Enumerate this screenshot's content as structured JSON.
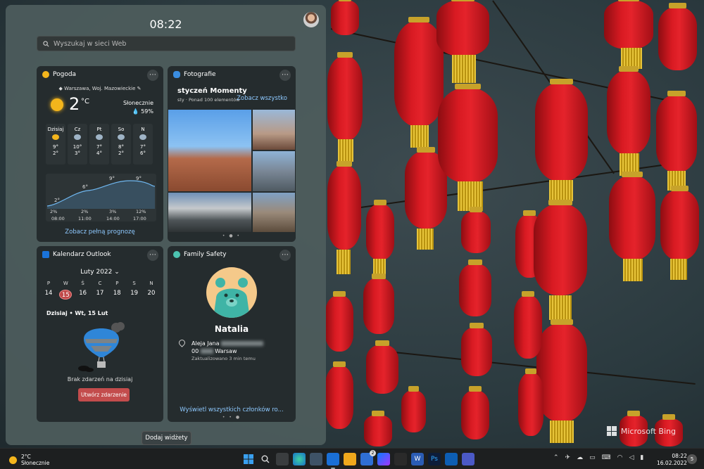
{
  "board": {
    "time": "08:22",
    "search_placeholder": "Wyszukaj w sieci Web",
    "add_widgets": "Dodaj widżety"
  },
  "weather": {
    "title": "Pogoda",
    "location": "Warszawa, Woj. Mazowieckie",
    "temp": "2",
    "unit": "°C",
    "condition": "Słonecznie",
    "precip": "59%",
    "days": [
      {
        "name": "Dzisiaj",
        "hi": "9°",
        "lo": "2°"
      },
      {
        "name": "Cz",
        "hi": "10°",
        "lo": "3°"
      },
      {
        "name": "Pt",
        "hi": "7°",
        "lo": "4°"
      },
      {
        "name": "So",
        "hi": "8°",
        "lo": "2°"
      },
      {
        "name": "N",
        "hi": "7°",
        "lo": "6°"
      }
    ],
    "graph_temps": [
      "2°",
      "6°",
      "9°",
      "9°"
    ],
    "graph_precip": [
      "2%",
      "2%",
      "3%",
      "12%"
    ],
    "graph_times": [
      "08:00",
      "11:00",
      "14:00",
      "17:00"
    ],
    "forecast_link": "Zobacz pełną prognozę"
  },
  "photos": {
    "title": "Fotografie",
    "heading": "styczeń Momenty",
    "subtitle": "sty · Ponad 100 elementów",
    "see_all": "Zobacz wszystko"
  },
  "calendar": {
    "title": "Kalendarz Outlook",
    "month": "Luty 2022",
    "weekdays": [
      "P",
      "W",
      "Ś",
      "C",
      "P",
      "S",
      "N"
    ],
    "dates": [
      "14",
      "15",
      "16",
      "17",
      "18",
      "19",
      "20"
    ],
    "today_line": "Dzisiaj • Wt, 15 Lut",
    "no_events": "Brak zdarzeń na dzisiaj",
    "create_event": "Utwórz zdarzenie"
  },
  "family": {
    "title": "Family Safety",
    "name": "Natalia",
    "address_line1": "Aleja Jana",
    "address_line2_prefix": "00",
    "address_city": "Warsaw",
    "updated": "Zaktualizowano 3 min temu",
    "see_all": "Wyświetl wszystkich członków ro..."
  },
  "wallpaper": {
    "credit": "Microsoft Bing"
  },
  "taskbar": {
    "weather_temp": "2°C",
    "weather_desc": "Słonecznie",
    "time": "08:22",
    "date": "16.02.2022",
    "notifications": "5",
    "badge": "2"
  },
  "colors": {
    "accent_link": "#8ec9ff",
    "create_button": "#c34c4c",
    "today_highlight": "#c04a4a"
  }
}
